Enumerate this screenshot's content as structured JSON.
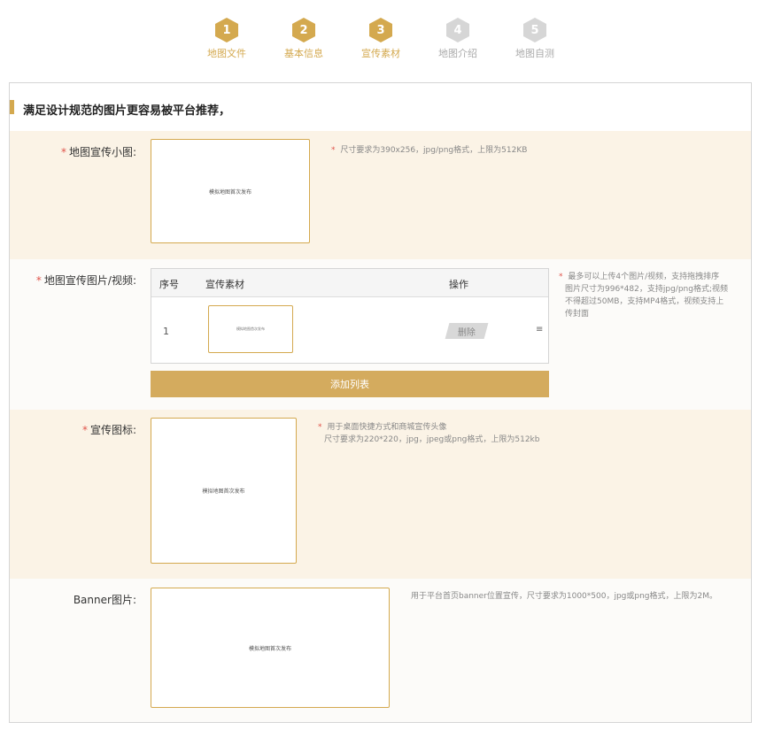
{
  "steps": [
    {
      "num": "1",
      "label": "地图文件",
      "active": true
    },
    {
      "num": "2",
      "label": "基本信息",
      "active": true
    },
    {
      "num": "3",
      "label": "宣传素材",
      "active": true
    },
    {
      "num": "4",
      "label": "地图介绍",
      "active": false
    },
    {
      "num": "5",
      "label": "地图自测",
      "active": false
    }
  ],
  "panel": {
    "title": "满足设计规范的图片更容易被平台推荐，"
  },
  "rows": {
    "small_image": {
      "required_mark": "*",
      "label": "地图宣传小图:",
      "upload_text": "模拟地图首次发布",
      "hint_mark": "*",
      "hint": "尺寸要求为390x256，jpg/png格式，上限为512KB"
    },
    "media": {
      "required_mark": "*",
      "label": "地图宣传图片/视频:",
      "table": {
        "headers": {
          "index": "序号",
          "material": "宣传素材",
          "action": "操作"
        },
        "rows": [
          {
            "index": "1",
            "thumb_text": "模拟地图首次发布",
            "delete_label": "删除",
            "drag_icon": "≡"
          }
        ]
      },
      "add_button": "添加列表",
      "hint_mark": "*",
      "hint_lines": [
        "最多可以上传4个图片/视频，支持拖拽排序",
        "图片尺寸为996*482，支持jpg/png格式;视频",
        "不得超过50MB，支持MP4格式，视频支持上",
        "传封面"
      ]
    },
    "icon": {
      "required_mark": "*",
      "label": "宣传图标:",
      "upload_text": "模拟地图首次发布",
      "hint_mark": "*",
      "hint_lines": [
        "用于桌面快捷方式和商城宣传头像",
        "尺寸要求为220*220，jpg，jpeg或png格式，上限为512kb"
      ]
    },
    "banner": {
      "label": "Banner图片:",
      "upload_text": "模拟地图首次发布",
      "hint": "用于平台首页banner位置宣传，尺寸要求为1000*500，jpg或png格式，上限为2M。"
    }
  },
  "colors": {
    "accent": "#d4a94f",
    "cream": "#fbf3e6",
    "required": "#e0534a"
  }
}
